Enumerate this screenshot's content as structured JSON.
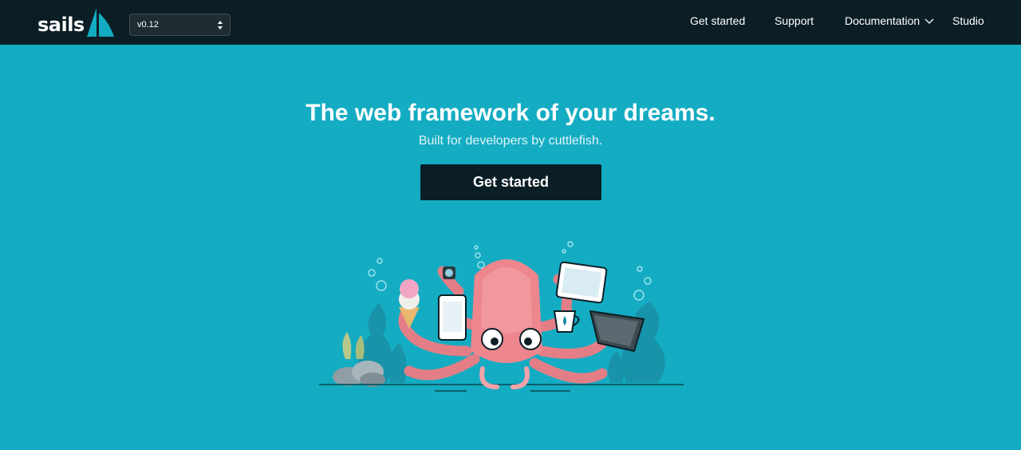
{
  "brand": {
    "name": "sails"
  },
  "version_select": {
    "selected": "v0.12"
  },
  "nav": {
    "get_started": "Get started",
    "support": "Support",
    "documentation": "Documentation",
    "studio": "Studio"
  },
  "hero": {
    "title": "The web framework of your dreams.",
    "subtitle": "Built for developers by cuttlefish.",
    "cta_label": "Get started"
  },
  "colors": {
    "navbar": "#0b1e26",
    "background": "#14acc2",
    "cta": "#0b1e26",
    "squid": "#ee868e",
    "seaweed": "#1a8fa5"
  },
  "icons": {
    "select_arrows": "updown-arrows-icon",
    "docs_dropdown": "chevron-down-icon",
    "logo": "sailboat-icon"
  }
}
